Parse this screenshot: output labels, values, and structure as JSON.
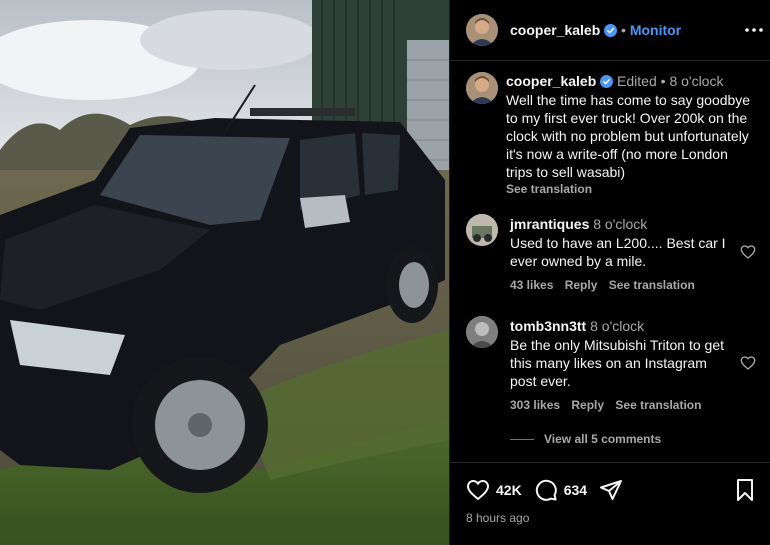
{
  "header": {
    "username": "cooper_kaleb",
    "separator": "•",
    "follow_label": "Monitor"
  },
  "post": {
    "username": "cooper_kaleb",
    "edited": "Edited",
    "dot": "•",
    "time": "8 o'clock",
    "caption": "Well the time has come to say goodbye to my first ever truck! Over 200k on the clock with no problem but unfortunately it's now a write-off (no more London trips to sell wasabi)",
    "see_translation": "See translation"
  },
  "comments": [
    {
      "username": "jmrantiques",
      "time": "8 o'clock",
      "text": "Used to have an L200.... Best car I ever owned by a mile.",
      "likes": "43 likes",
      "reply": "Reply",
      "see_translation": "See translation"
    },
    {
      "username": "tomb3nn3tt",
      "time": "8 o'clock",
      "text": "Be the only Mitsubishi Triton to get this many likes on an Instagram post ever.",
      "likes": "303 likes",
      "reply": "Reply",
      "see_translation": "See translation"
    }
  ],
  "view_all": "View all 5 comments",
  "footer": {
    "likes_count": "42K",
    "comments_count": "634",
    "time_ago": "8 hours ago"
  },
  "icons": {
    "verified": "verified-badge-icon",
    "more": "more-options-icon",
    "like": "heart-icon",
    "comment": "comment-bubble-icon",
    "share": "share-icon",
    "save": "bookmark-icon"
  },
  "colors": {
    "accent": "#4a95f6",
    "background": "#000000",
    "muted": "#a8a8a8"
  }
}
